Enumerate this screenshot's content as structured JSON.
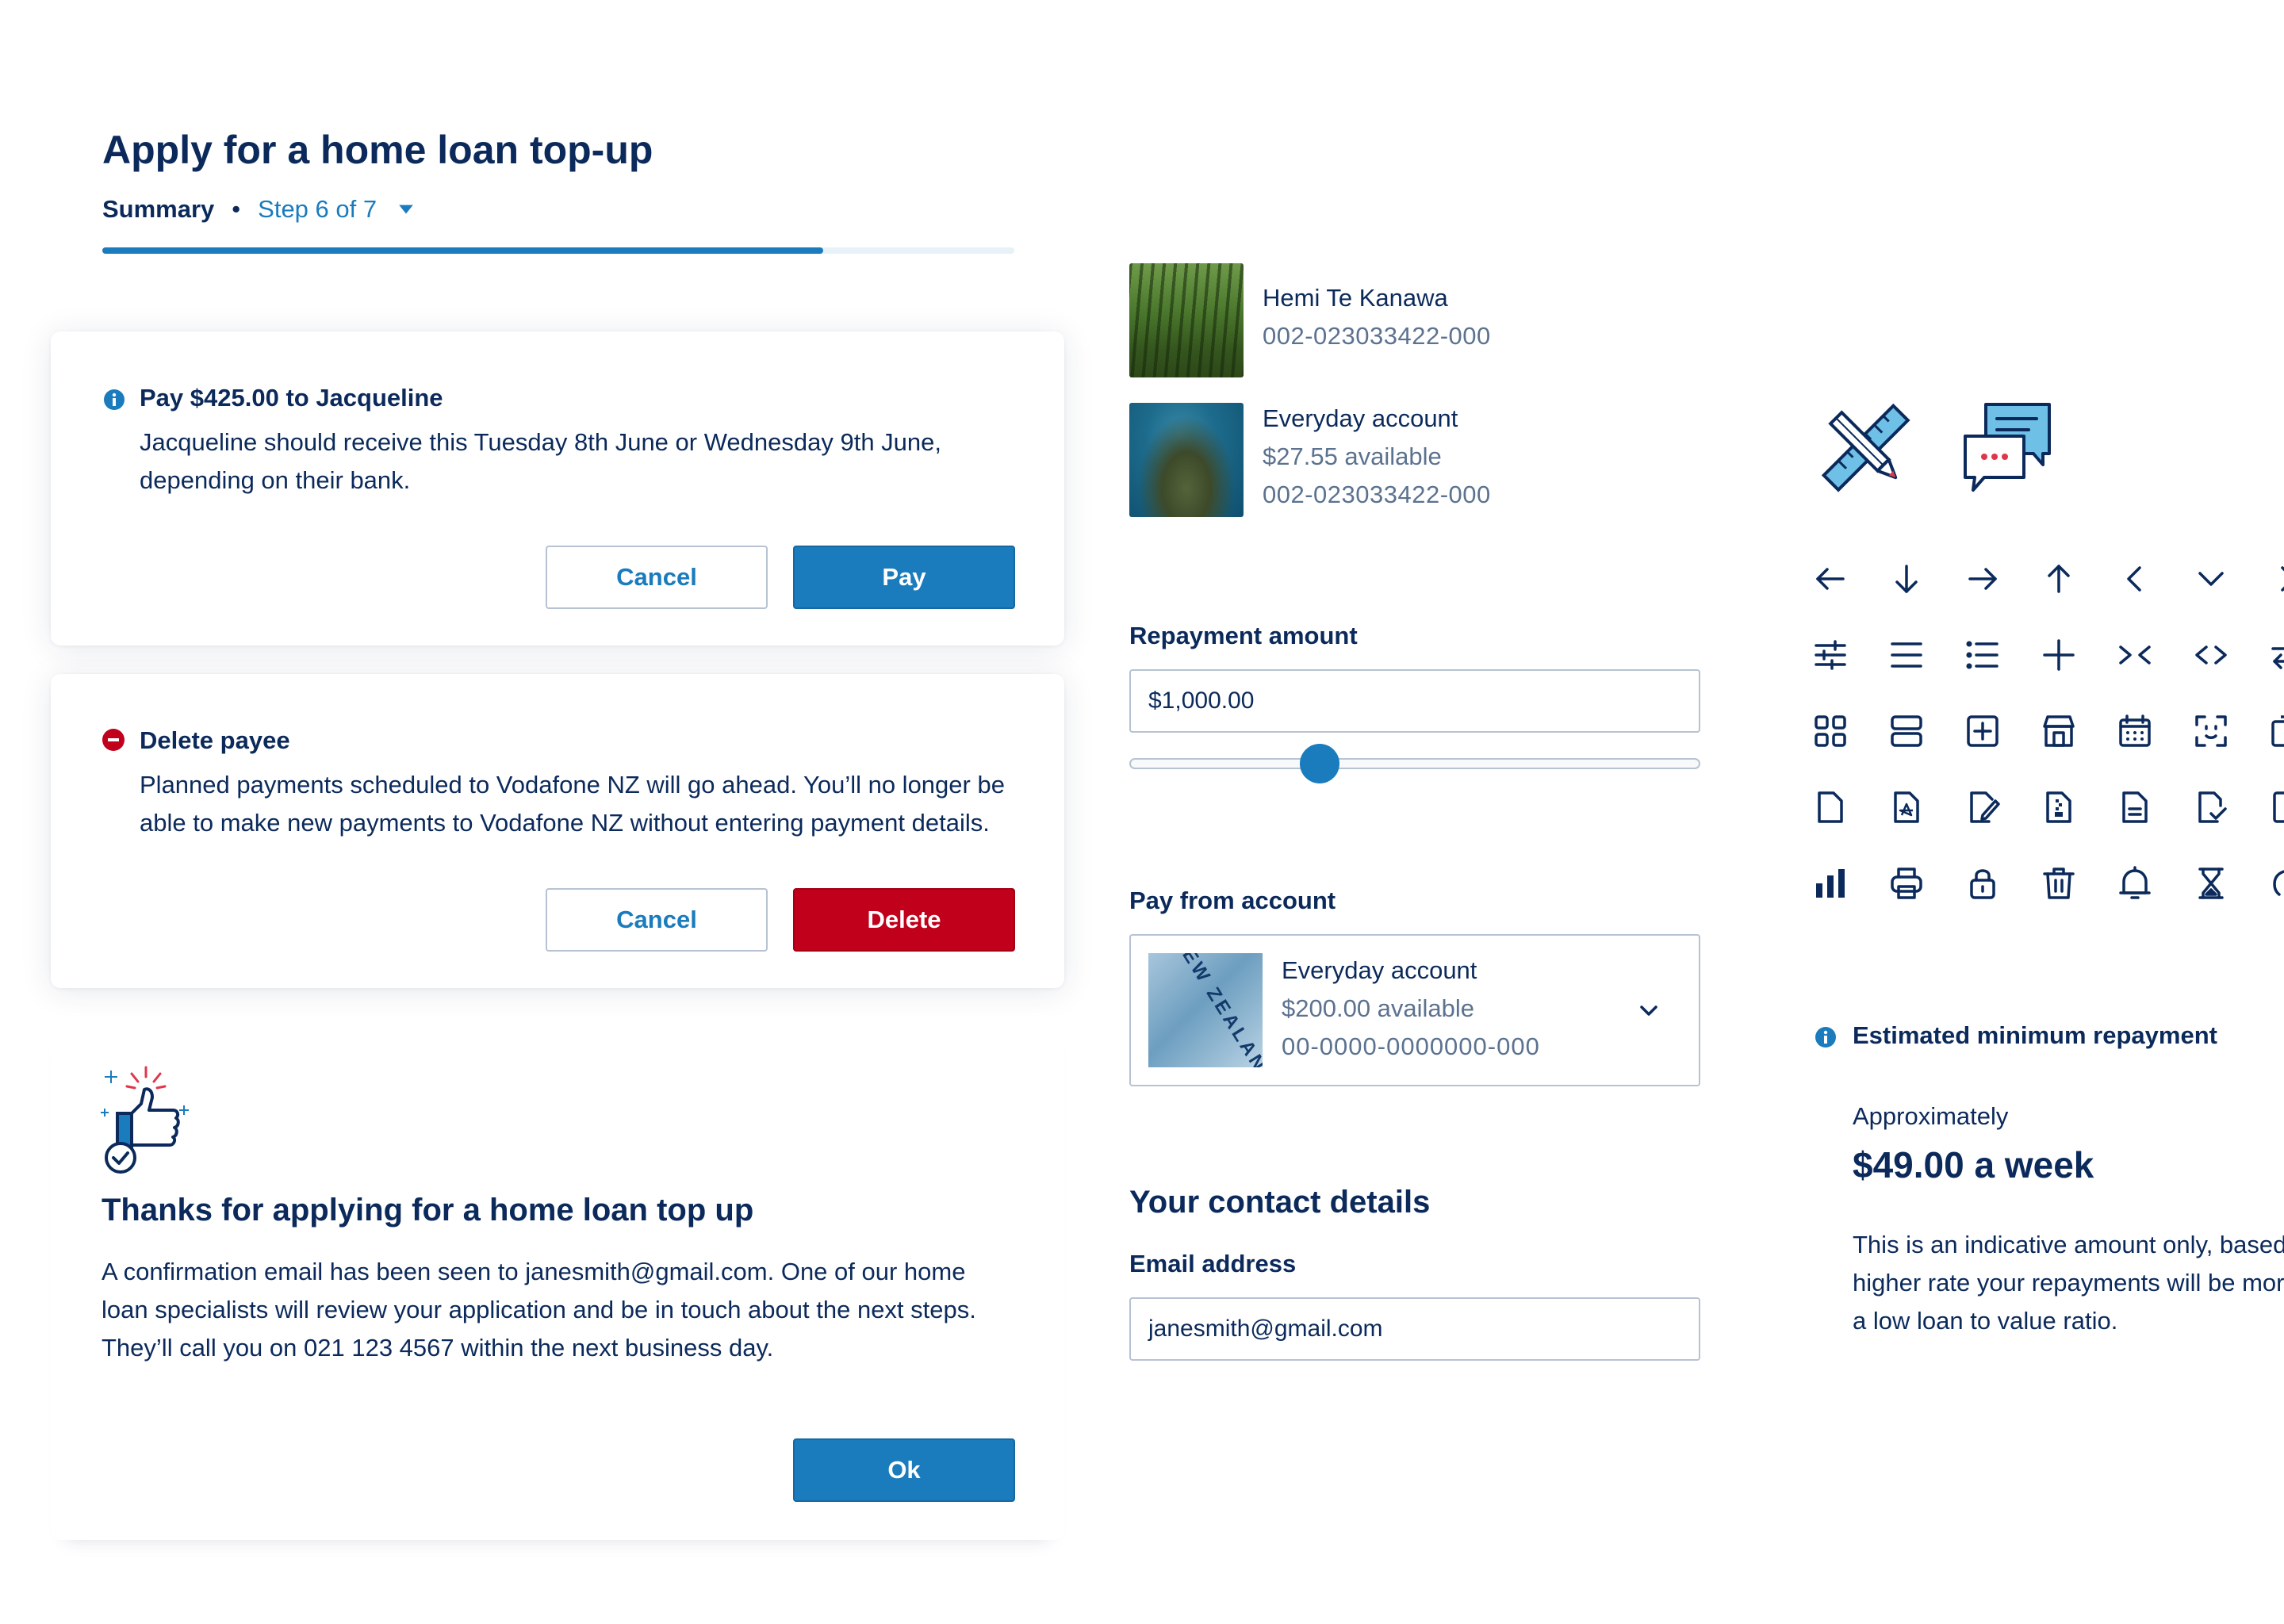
{
  "header": {
    "title": "Apply for a home loan top-up",
    "step_name": "Summary",
    "step_separator": "•",
    "step_counter": "Step 6 of 7",
    "progress_fraction": 0.79
  },
  "pay_card": {
    "title": "Pay $425.00 to Jacqueline",
    "body": "Jacqueline should receive this Tuesday 8th June or Wednesday 9th June, depending on their bank.",
    "cancel_label": "Cancel",
    "pay_label": "Pay"
  },
  "delete_card": {
    "title": "Delete payee",
    "body": "Planned payments scheduled to Vodafone NZ will go ahead. You’ll no longer be able to make new payments to Vodafone NZ without entering payment details.",
    "cancel_label": "Cancel",
    "delete_label": "Delete"
  },
  "thanks_card": {
    "title": "Thanks for applying for a home loan top up",
    "body": "A confirmation email has been seen to janesmith@gmail.com. One of our home loan specialists will review your application and be in touch about the next steps. They’ll call you on 021 123 4567 within the next business day.",
    "ok_label": "Ok"
  },
  "accounts": [
    {
      "name": "Hemi Te Kanawa",
      "balance": "",
      "number": "002-023033422-000"
    },
    {
      "name": "Everyday account",
      "balance": "$27.55 available",
      "number": "002-023033422-000"
    }
  ],
  "repayment": {
    "label": "Repayment amount",
    "value": "$1,000.00",
    "slider_fraction": 0.33
  },
  "pay_from": {
    "label": "Pay from account",
    "account_name": "Everyday account",
    "balance": "$200.00 available",
    "number": "00-0000-0000000-000",
    "card_image_text": "NEW ZEALAND · RESERVE BANK"
  },
  "contact": {
    "title": "Your contact details",
    "email_label": "Email address",
    "email_value": "janesmith@gmail.com"
  },
  "estimate": {
    "title": "Estimated minimum repayment",
    "approx": "Approximately",
    "amount": "$49.00 a week",
    "body_lines": [
      "This is an indicative amount only, based",
      "higher rate your repayments will be mor",
      "a low loan to value ratio."
    ]
  },
  "colors": {
    "navy": "#0b2a5b",
    "accent_blue": "#1a7bbd",
    "danger_red": "#c1001b",
    "muted_text": "#5b7290",
    "border": "#b7c3d2"
  },
  "icon_grid": [
    [
      "arrow-left-icon",
      "arrow-down-icon",
      "arrow-right-icon",
      "arrow-up-icon",
      "chevron-left-icon",
      "chevron-down-icon"
    ],
    [
      "filter-sliders-icon",
      "menu-icon",
      "list-icon",
      "plus-icon",
      "collapse-icon",
      "code-icon"
    ],
    [
      "grid-icon",
      "server-icon",
      "add-box-icon",
      "store-icon",
      "calendar-icon",
      "face-scan-icon"
    ],
    [
      "document-icon",
      "pdf-document-icon",
      "edit-document-icon",
      "zip-document-icon",
      "text-document-icon",
      "check-document-icon"
    ],
    [
      "bar-chart-icon",
      "printer-icon",
      "lock-icon",
      "trash-icon",
      "bell-icon",
      "hourglass-icon"
    ]
  ]
}
